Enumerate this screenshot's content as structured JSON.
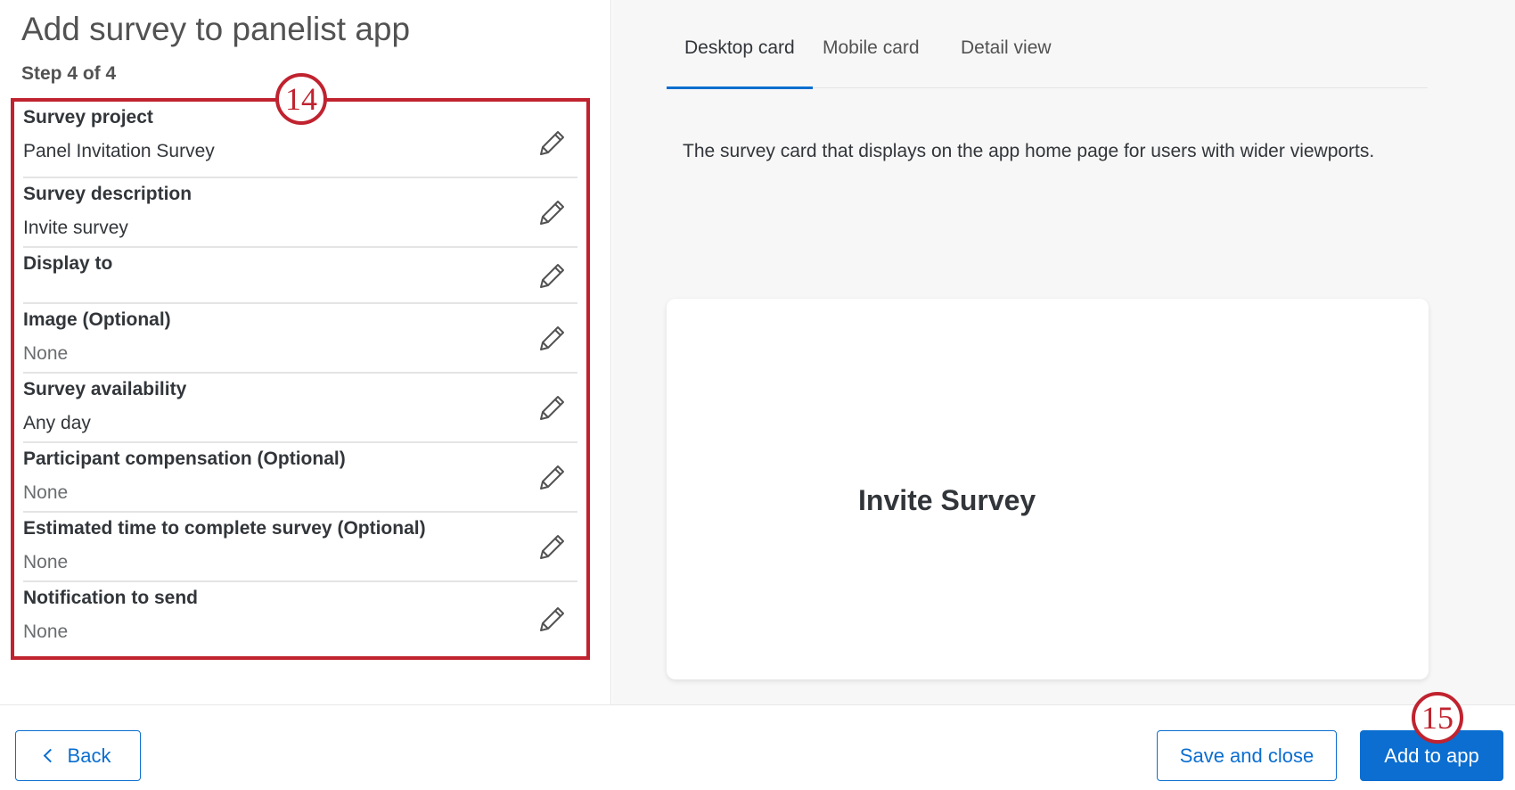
{
  "title": "Add survey to panelist app",
  "step": "Step 4 of 4",
  "callouts": {
    "a": "14",
    "b": "15"
  },
  "fields": [
    {
      "label": "Survey project",
      "value": "Panel Invitation Survey"
    },
    {
      "label": "Survey description",
      "value": "Invite survey"
    },
    {
      "label": "Display to",
      "value": ""
    },
    {
      "label": "Image (Optional)",
      "value": "None"
    },
    {
      "label": "Survey availability",
      "value": "Any day"
    },
    {
      "label": "Participant compensation (Optional)",
      "value": "None"
    },
    {
      "label": "Estimated time to complete survey (Optional)",
      "value": "None"
    },
    {
      "label": "Notification to send",
      "value": "None"
    }
  ],
  "tabs": [
    "Desktop card",
    "Mobile card",
    "Detail view"
  ],
  "description": "The survey card that displays on the app home page for users with wider viewports.",
  "card_title": "Invite Survey",
  "footer": {
    "back": "Back",
    "save": "Save and close",
    "add": "Add to app"
  },
  "colors": {
    "accent": "#0b6ed0",
    "callout": "#c0232f"
  }
}
